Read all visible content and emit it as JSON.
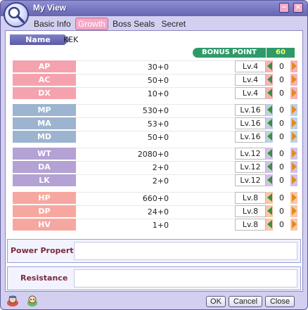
{
  "window": {
    "title": "My View",
    "minimize_label": "−",
    "close_label": "×"
  },
  "tabs": [
    {
      "label": "Basic Info",
      "active": false
    },
    {
      "label": "Growth",
      "active": true
    },
    {
      "label": "Boss Seals",
      "active": false
    },
    {
      "label": "Secret",
      "active": false
    }
  ],
  "name": {
    "label": "Name",
    "value": "KEK"
  },
  "bonus": {
    "label": "BONUS POINT",
    "value": "60"
  },
  "stats": [
    {
      "label": "AP",
      "value": "30+0",
      "level": "Lv.4",
      "points": "0",
      "group": "red"
    },
    {
      "label": "AC",
      "value": "50+0",
      "level": "Lv.4",
      "points": "0",
      "group": "red"
    },
    {
      "label": "DX",
      "value": "10+0",
      "level": "Lv.4",
      "points": "0",
      "group": "red"
    },
    {
      "label": "MP",
      "value": "530+0",
      "level": "Lv.16",
      "points": "0",
      "group": "blue"
    },
    {
      "label": "MA",
      "value": "53+0",
      "level": "Lv.16",
      "points": "0",
      "group": "blue"
    },
    {
      "label": "MD",
      "value": "50+0",
      "level": "Lv.16",
      "points": "0",
      "group": "blue"
    },
    {
      "label": "WT",
      "value": "2080+0",
      "level": "Lv.12",
      "points": "0",
      "group": "purple"
    },
    {
      "label": "DA",
      "value": "2+0",
      "level": "Lv.12",
      "points": "0",
      "group": "purple"
    },
    {
      "label": "LK",
      "value": "2+0",
      "level": "Lv.12",
      "points": "0",
      "group": "purple"
    },
    {
      "label": "HP",
      "value": "660+0",
      "level": "Lv.8",
      "points": "0",
      "group": "orange"
    },
    {
      "label": "DP",
      "value": "24+0",
      "level": "Lv.8",
      "points": "0",
      "group": "orange"
    },
    {
      "label": "HV",
      "value": "1+0",
      "level": "Lv.8",
      "points": "0",
      "group": "orange"
    }
  ],
  "power_property": {
    "label": "Power Property",
    "value": ""
  },
  "resistance": {
    "label": "Resistance",
    "value": ""
  },
  "footer": {
    "ok_label": "OK",
    "cancel_label": "Cancel",
    "close_label": "Close"
  },
  "icons": {
    "app": "magnifier-icon",
    "footer_left_1": "character-icon",
    "footer_left_2": "pet-icon",
    "decrease": "arrow-left-icon",
    "increase": "arrow-right-icon"
  },
  "colors": {
    "bonus_bg": "#2e9a6a",
    "bonus_value": "#f6ff66",
    "active_tab": "#f4a7c7"
  }
}
